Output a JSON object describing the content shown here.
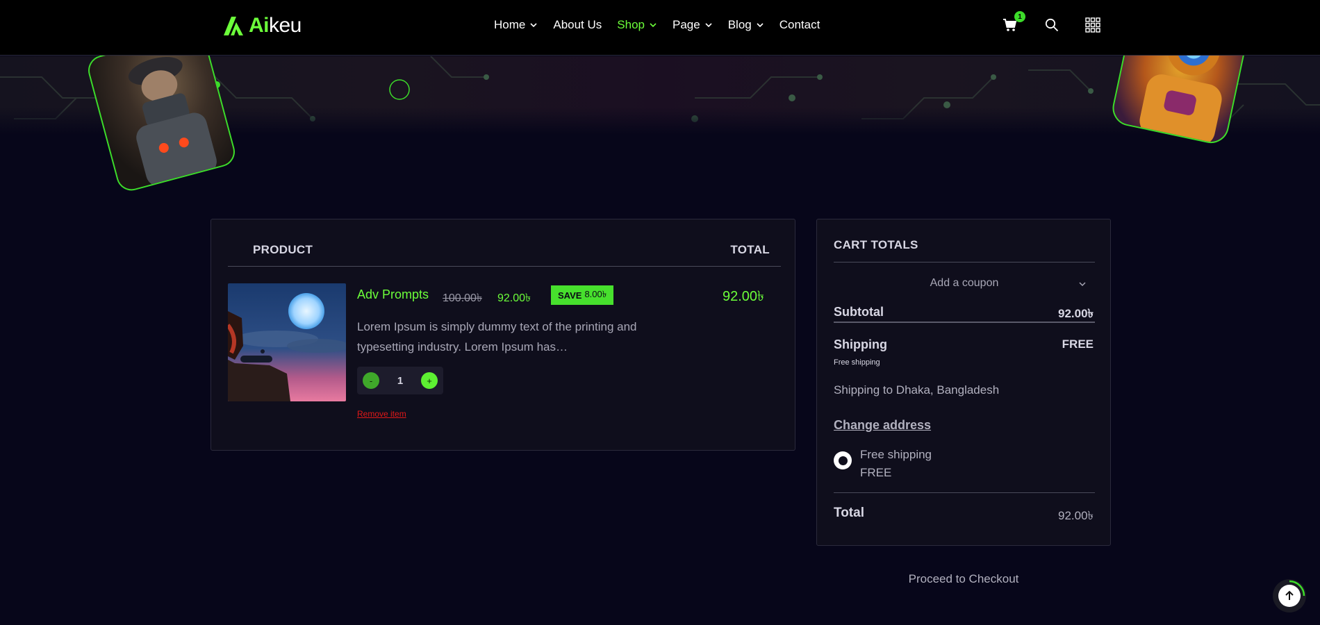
{
  "brand": {
    "name_accent": "Ai",
    "name_rest": "keu"
  },
  "nav": {
    "items": [
      {
        "label": "Home",
        "has_dropdown": true,
        "active": false
      },
      {
        "label": "About Us",
        "has_dropdown": false,
        "active": false
      },
      {
        "label": "Shop",
        "has_dropdown": true,
        "active": true
      },
      {
        "label": "Page",
        "has_dropdown": true,
        "active": false
      },
      {
        "label": "Blog",
        "has_dropdown": true,
        "active": false
      },
      {
        "label": "Contact",
        "has_dropdown": false,
        "active": false
      }
    ]
  },
  "header": {
    "cart_count": "1",
    "icons": [
      "cart-icon",
      "search-icon",
      "grid-menu-icon"
    ]
  },
  "cart": {
    "col_product": "PRODUCT",
    "col_total": "TOTAL",
    "item": {
      "name": "Adv Prompts",
      "old_price": "100.00৳",
      "new_price": "92.00৳",
      "save_label": "SAVE",
      "save_amount": "8.00৳",
      "line_total": "92.00৳",
      "description": "Lorem Ipsum is simply dummy text of the printing and typesetting industry. Lorem Ipsum has…",
      "quantity": "1",
      "minus_label": "-",
      "plus_label": "+",
      "remove_label": "Remove item"
    }
  },
  "totals": {
    "title": "CART TOTALS",
    "coupon_label": "Add a coupon",
    "subtotal_label": "Subtotal",
    "subtotal_value": "92.00৳",
    "shipping_label": "Shipping",
    "shipping_value": "FREE",
    "shipping_note": "Free shipping",
    "shipping_to": "Shipping to Dhaka, Bangladesh",
    "change_address": "Change address",
    "option_name": "Free shipping",
    "option_price": "FREE",
    "total_label": "Total",
    "total_value": "92.00৳"
  },
  "checkout_label": "Proceed to Checkout",
  "colors": {
    "accent": "#6cff3a",
    "background": "#07061a",
    "panel": "#0f0e1c",
    "danger": "#e01818"
  }
}
